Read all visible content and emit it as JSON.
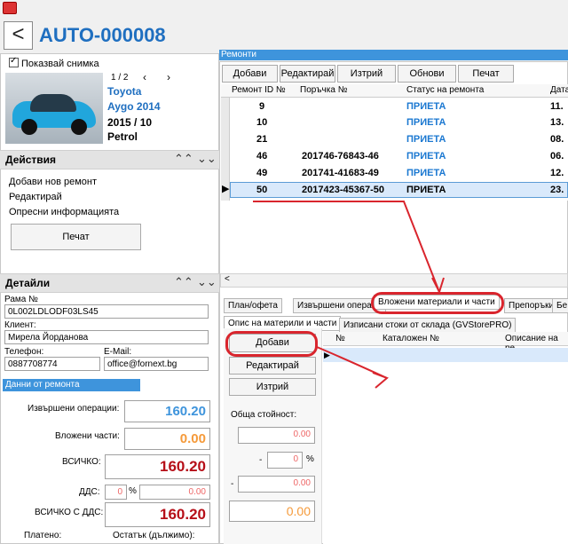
{
  "window": {
    "title": "AUTO-000008"
  },
  "vehicle": {
    "show_photo_label": "Показвай снимка",
    "photo_index": "1 / 2",
    "make": "Toyota",
    "model": "Aygo 2014",
    "year_line": "2015   / 10",
    "fuel": "Petrol"
  },
  "actions": {
    "title": "Действия",
    "items": [
      "Добави нов ремонт",
      "Редактирай",
      "Опресни информацията"
    ],
    "print_label": "Печат"
  },
  "details": {
    "title": "Детайли",
    "frame_label": "Рама №",
    "frame_value": "0L002LDLODF03LS45",
    "client_label": "Клиент:",
    "client_value": "Мирела Йорданова",
    "phone_label": "Телефон:",
    "phone_value": "0887708774",
    "email_label": "E-Mail:",
    "email_value": "office@fornext.bg",
    "repair_data_label": "Данни от ремонта",
    "operations_label": "Извършени операции:",
    "operations_value": "160.20",
    "parts_label": "Вложени части:",
    "parts_value": "0.00",
    "total_label": "ВСИЧКО:",
    "total_value": "160.20",
    "vat_label": "ДДС:",
    "vat_percent": "0",
    "vat_value": "0.00",
    "total_vat_label": "ВСИЧКО С ДДС:",
    "total_vat_value": "160.20",
    "paid_label": "Платено:",
    "remaining_label": "Остатък (дължимо):"
  },
  "repairs": {
    "title": "Ремонти",
    "toolbar": [
      "Добави",
      "Редактирай",
      "Изтрий",
      "Обнови",
      "Печат"
    ],
    "columns": [
      "Ремонт ID №",
      "Поръчка №",
      "Статус на ремонта",
      "Дата"
    ],
    "rows": [
      {
        "id": "9",
        "order": "",
        "status": "ПРИЕТА",
        "date": "11."
      },
      {
        "id": "10",
        "order": "",
        "status": "ПРИЕТА",
        "date": "13."
      },
      {
        "id": "21",
        "order": "",
        "status": "ПРИЕТА",
        "date": "08."
      },
      {
        "id": "46",
        "order": "201746-76843-46",
        "status": "ПРИЕТА",
        "date": "06."
      },
      {
        "id": "49",
        "order": "201741-41683-49",
        "status": "ПРИЕТА",
        "date": "12."
      },
      {
        "id": "50",
        "order": "2017423-45367-50",
        "status": "ПРИЕТА",
        "date": "23."
      }
    ]
  },
  "tabs": {
    "main": [
      "План/офета",
      "Извършени операци",
      "Вложени материали и части",
      "Препоръки",
      "Бе"
    ],
    "sub": [
      "Опис на материли и части",
      "Изписани стоки от склада (GVStorePRO)"
    ]
  },
  "parts_panel": {
    "add_label": "Добави",
    "edit_label": "Редактирай",
    "delete_label": "Изтрий",
    "total_cost_label": "Обща стойност:",
    "cost_value": "0.00",
    "discount_percent": "0",
    "discount_value": "0.00",
    "final_value": "0.00",
    "columns": [
      "№",
      "Каталожен №",
      "Описание на ре"
    ]
  },
  "colors": {
    "accent": "#1f6fc0",
    "highlight": "#d9252d",
    "status": "#1b78d1"
  }
}
